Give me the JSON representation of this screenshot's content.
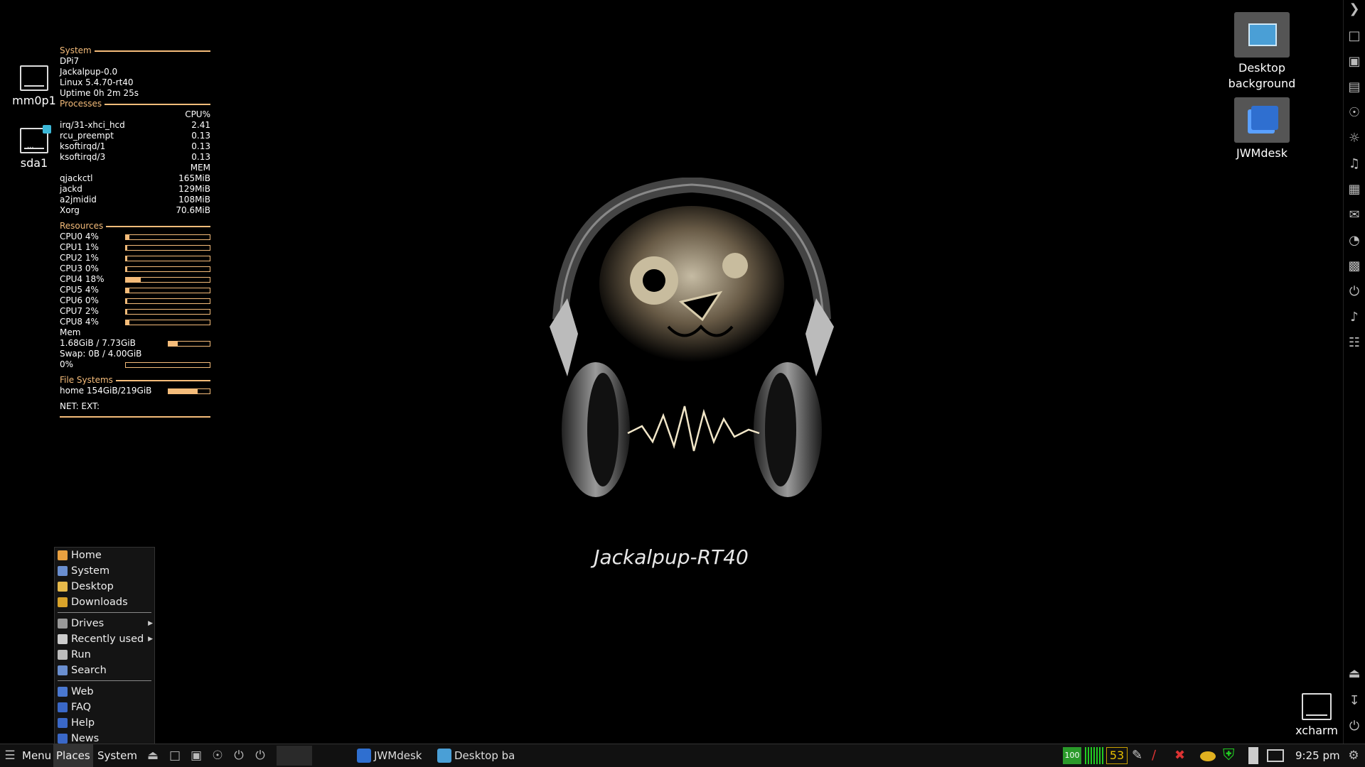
{
  "conky": {
    "system": {
      "heading": "System",
      "lines": [
        "DPi7",
        "Jackalpup-0.0",
        "Linux 5.4.70-rt40",
        "Uptime 0h 2m 25s"
      ]
    },
    "processes": {
      "heading": "Processes",
      "cpu_label": "CPU%",
      "cpu": [
        {
          "name": "irq/31-xhci_hcd",
          "value": "2.41"
        },
        {
          "name": "rcu_preempt",
          "value": "0.13"
        },
        {
          "name": "ksoftirqd/1",
          "value": "0.13"
        },
        {
          "name": "ksoftirqd/3",
          "value": "0.13"
        }
      ],
      "mem_label": "MEM",
      "mem": [
        {
          "name": "qjackctl",
          "value": "165MiB"
        },
        {
          "name": "jackd",
          "value": "129MiB"
        },
        {
          "name": "a2jmidid",
          "value": "108MiB"
        },
        {
          "name": "Xorg",
          "value": "70.6MiB"
        }
      ]
    },
    "resources": {
      "heading": "Resources",
      "cpus": [
        {
          "label": "CPU0 4%",
          "percent": 4
        },
        {
          "label": "CPU1 1%",
          "percent": 1
        },
        {
          "label": "CPU2 1%",
          "percent": 1
        },
        {
          "label": "CPU3 0%",
          "percent": 0
        },
        {
          "label": "CPU4 18%",
          "percent": 18
        },
        {
          "label": "CPU5 4%",
          "percent": 4
        },
        {
          "label": "CPU6 0%",
          "percent": 0
        },
        {
          "label": "CPU7 2%",
          "percent": 2
        },
        {
          "label": "CPU8 4%",
          "percent": 4
        }
      ],
      "mem_heading": "Mem",
      "mem_label": "1.68GiB / 7.73GiB",
      "mem_percent": 22,
      "swap_label": "Swap: 0B  / 4.00GiB",
      "swap_pct_label": "0%",
      "swap_percent": 0
    },
    "filesystems": {
      "heading": "File Systems",
      "home_label": "home 154GiB/219GiB",
      "home_percent": 70
    },
    "net_label": "NET: EXT:"
  },
  "desktop": {
    "drives": [
      "mm0p1",
      "sda1"
    ],
    "apps": [
      {
        "label": "Desktop background",
        "icon": "image-settings-icon"
      },
      {
        "label": "JWMdesk",
        "icon": "windows-icon"
      }
    ],
    "xcharm": "xcharm",
    "caption": "Jackalpup-RT40"
  },
  "menu": {
    "items": [
      {
        "label": "Home",
        "icon": "home-icon",
        "color": "#e8a040"
      },
      {
        "label": "System",
        "icon": "system-icon",
        "color": "#6a8fd0"
      },
      {
        "label": "Desktop",
        "icon": "folder-icon",
        "color": "#e6b94a"
      },
      {
        "label": "Downloads",
        "icon": "download-folder-icon",
        "color": "#d9a32a"
      },
      {
        "label": "Drives",
        "icon": "drive-icon",
        "color": "#999999",
        "submenu": true
      },
      {
        "label": "Recently used",
        "icon": "recent-icon",
        "color": "#cccccc",
        "submenu": true
      },
      {
        "label": "Run",
        "icon": "gear-icon",
        "color": "#bbbbbb"
      },
      {
        "label": "Search",
        "icon": "search-icon",
        "color": "#6a8fd0"
      },
      {
        "label": "Web",
        "icon": "globe-icon",
        "color": "#4a78d0"
      },
      {
        "label": "FAQ",
        "icon": "info-icon",
        "color": "#3a68c8"
      },
      {
        "label": "Help",
        "icon": "info-icon",
        "color": "#3a68c8"
      },
      {
        "label": "News",
        "icon": "info-icon",
        "color": "#3a68c8"
      }
    ]
  },
  "taskbar": {
    "menu_label": "Menu",
    "places_label": "Places",
    "system_label": "System",
    "tasks": [
      {
        "label": "JWMdesk",
        "icon": "windows-icon"
      },
      {
        "label": "Desktop ba",
        "icon": "image-settings-icon"
      }
    ],
    "battery_label": "100",
    "temp_label": "53",
    "clock": "9:25 pm"
  },
  "colors": {
    "accent": "#f5bc7a",
    "background": "#000000",
    "taskbar": "#111111"
  }
}
